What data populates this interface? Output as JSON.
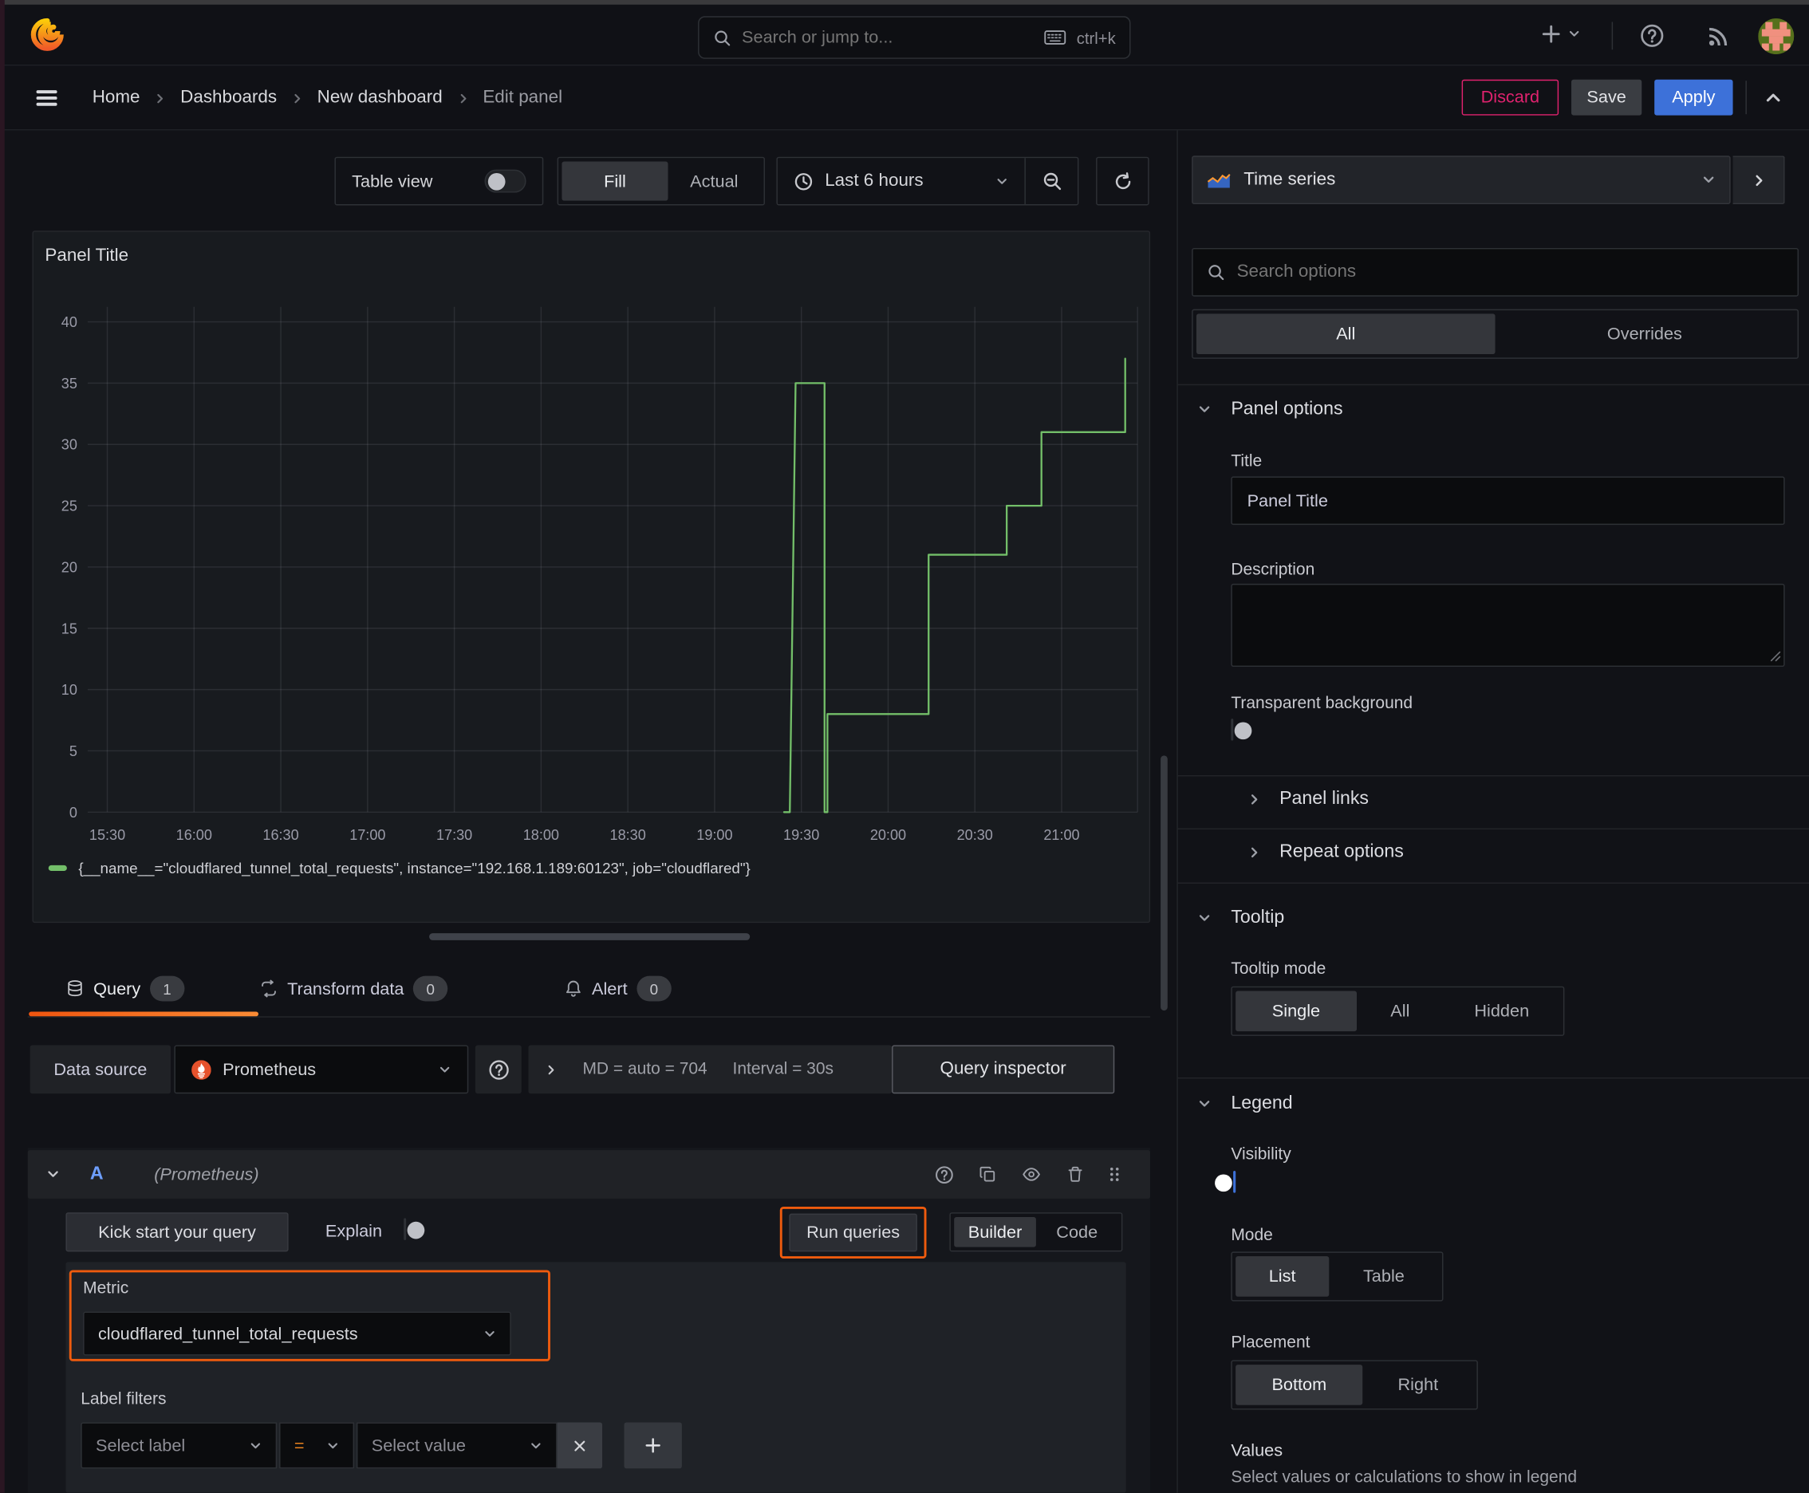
{
  "topnav": {
    "search_placeholder": "Search or jump to...",
    "search_shortcut": "ctrl+k"
  },
  "nav": {
    "breadcrumb": [
      "Home",
      "Dashboards",
      "New dashboard",
      "Edit panel"
    ],
    "discard": "Discard",
    "save": "Save",
    "apply": "Apply"
  },
  "toolbar": {
    "table_view": "Table view",
    "fill": "Fill",
    "actual": "Actual",
    "time_range": "Last 6 hours"
  },
  "panel": {
    "title": "Panel Title",
    "legend_series": "{__name__=\"cloudflared_tunnel_total_requests\", instance=\"192.168.1.189:60123\", job=\"cloudflared\"}"
  },
  "chart_data": {
    "type": "line",
    "style": "step",
    "title": "Panel Title",
    "x_ticks": [
      "15:30",
      "16:00",
      "16:30",
      "17:00",
      "17:30",
      "18:00",
      "18:30",
      "19:00",
      "19:30",
      "20:00",
      "20:30",
      "21:00"
    ],
    "y_ticks": [
      0,
      5,
      10,
      15,
      20,
      25,
      30,
      35,
      40
    ],
    "ylim": [
      0,
      42
    ],
    "grid": "on",
    "legend_position": "bottom",
    "series": [
      {
        "name": "{__name__=\"cloudflared_tunnel_total_requests\", instance=\"192.168.1.189:60123\", job=\"cloudflared\"}",
        "color": "#73bf69",
        "points": [
          {
            "time": "19:24",
            "value": 0
          },
          {
            "time": "19:26",
            "value": 0
          },
          {
            "time": "19:28",
            "value": 35
          },
          {
            "time": "19:38",
            "value": 35
          },
          {
            "time": "19:38",
            "value": 0
          },
          {
            "time": "19:39",
            "value": 0
          },
          {
            "time": "19:39",
            "value": 8
          },
          {
            "time": "20:14",
            "value": 8
          },
          {
            "time": "20:14",
            "value": 21
          },
          {
            "time": "20:41",
            "value": 21
          },
          {
            "time": "20:41",
            "value": 25
          },
          {
            "time": "20:53",
            "value": 25
          },
          {
            "time": "20:53",
            "value": 31
          },
          {
            "time": "21:22",
            "value": 31
          },
          {
            "time": "21:22",
            "value": 37
          }
        ]
      }
    ]
  },
  "tabs": {
    "query": "Query",
    "query_count": "1",
    "transform": "Transform data",
    "transform_count": "0",
    "alert": "Alert",
    "alert_count": "0"
  },
  "datasource_row": {
    "label": "Data source",
    "value": "Prometheus",
    "md_summary": "MD = auto = 704",
    "interval_summary": "Interval = 30s",
    "query_inspector": "Query inspector"
  },
  "query_editor": {
    "ref_id": "A",
    "ref_note": "(Prometheus)",
    "kick_start": "Kick start your query",
    "explain": "Explain",
    "run_queries": "Run queries",
    "builder": "Builder",
    "code": "Code",
    "metric_label": "Metric",
    "metric_value": "cloudflared_tunnel_total_requests",
    "label_filters_label": "Label filters",
    "select_label_placeholder": "Select label",
    "operator": "=",
    "select_value_placeholder": "Select value"
  },
  "options_pane": {
    "visualization": "Time series",
    "search_placeholder": "Search options",
    "tab_all": "All",
    "tab_overrides": "Overrides",
    "panel_options": "Panel options",
    "title_label": "Title",
    "title_value": "Panel Title",
    "description_label": "Description",
    "transparent_bg": "Transparent background",
    "panel_links": "Panel links",
    "repeat_options": "Repeat options",
    "tooltip": "Tooltip",
    "tooltip_mode": "Tooltip mode",
    "tooltip_single": "Single",
    "tooltip_all": "All",
    "tooltip_hidden": "Hidden",
    "legend": "Legend",
    "visibility": "Visibility",
    "mode": "Mode",
    "mode_list": "List",
    "mode_table": "Table",
    "placement": "Placement",
    "placement_bottom": "Bottom",
    "placement_right": "Right",
    "values_label": "Values",
    "values_desc": "Select values or calculations to show in legend"
  },
  "colors": {
    "accent_orange": "#ee5b0e",
    "series_green": "#73bf69",
    "primary_blue": "#3d71d9",
    "danger_pink": "#e0226e"
  }
}
